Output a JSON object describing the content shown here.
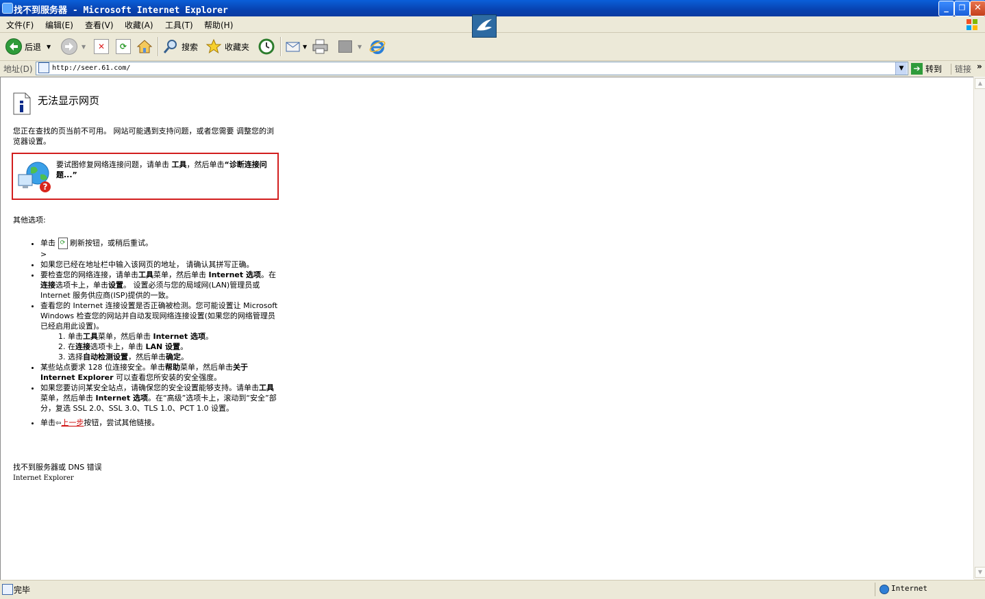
{
  "window": {
    "title": "找不到服务器 - Microsoft Internet Explorer"
  },
  "menu": [
    "文件(F)",
    "编辑(E)",
    "查看(V)",
    "收藏(A)",
    "工具(T)",
    "帮助(H)"
  ],
  "toolbar": {
    "back": "后退",
    "search": "搜索",
    "favorites": "收藏夹"
  },
  "address": {
    "label": "地址(D)",
    "url": "http://seer.61.com/",
    "go": "转到",
    "links": "链接"
  },
  "page": {
    "heading": "无法显示网页",
    "intro": "您正在查找的页当前不可用。 网站可能遇到支持问题，或者您需要 调整您的浏览器设置。",
    "diag_part1": "要试图修复网络连接问题，请单击 ",
    "diag_tools": "工具",
    "diag_part2": "，然后单击",
    "diag_bold": "“诊断连接问题...”",
    "other_options": "其他选项:",
    "b1_pre": "单击 ",
    "b1_post": " 刷新按钮，或稍后重试。",
    "b1_line2": ">",
    "b2": "如果您已经在地址栏中输入该网页的地址， 请确认其拼写正确。",
    "b3_a": "要检查您的网络连接，请单击",
    "b3_b": "工具",
    "b3_c": "菜单，然后单击 ",
    "b3_d": "Internet 选项",
    "b3_e": "。在",
    "b3_f": "连接",
    "b3_g": "选项卡上，单击",
    "b3_h": "设置",
    "b3_i": "。 设置必须与您的局域网(LAN)管理员或 Internet 服务供应商(ISP)提供的一致。",
    "b4": "查看您的 Internet 连接设置是否正确被检测。您可能设置让 Microsoft Windows 检查您的网站并自动发现网络连接设置(如果您的网络管理员已经启用此设置)。",
    "s1_a": "单击",
    "s1_b": "工具",
    "s1_c": "菜单，然后单击 ",
    "s1_d": "Internet 选项",
    "s1_e": "。",
    "s2_a": "在",
    "s2_b": "连接",
    "s2_c": "选项卡上，单击 ",
    "s2_d": "LAN 设置",
    "s2_e": "。",
    "s3_a": "选择",
    "s3_b": "自动检测设置",
    "s3_c": "，然后单击",
    "s3_d": "确定",
    "s3_e": "。",
    "b5_a": "某些站点要求 128 位连接安全。单击",
    "b5_b": "帮助",
    "b5_c": "菜单，然后单击",
    "b5_d": "关于 Internet Explorer",
    "b5_e": " 可以查看您所安装的安全强度。",
    "b6_a": "如果您要访问某安全站点，请确保您的安全设置能够支持。请单击",
    "b6_b": "工具",
    "b6_c": "菜单，然后单击 ",
    "b6_d": "Internet 选项",
    "b6_e": "。在“高级”选项卡上，滚动到“安全”部分，复选 SSL 2.0、SSL 3.0、TLS 1.0、PCT 1.0 设置。",
    "b7_a": "单击",
    "b7_link": "上一步",
    "b7_b": "按钮，尝试其他链接。",
    "footer1": "找不到服务器或 DNS 错误",
    "footer2": "Internet Explorer"
  },
  "status": {
    "text": "完毕",
    "zone": "Internet"
  }
}
